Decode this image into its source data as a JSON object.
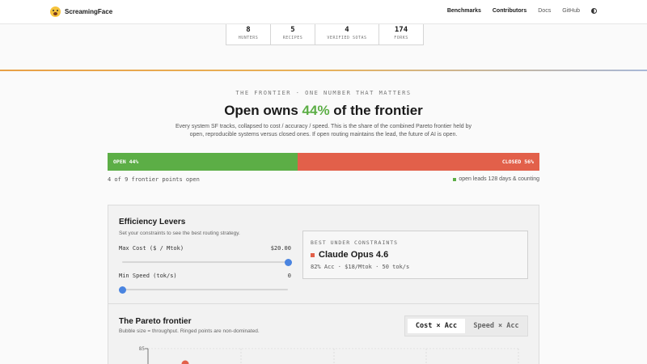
{
  "header": {
    "brand": "ScreamingFace",
    "logo_icon": "screaming-face-icon",
    "nav": [
      "Benchmarks",
      "Contributors",
      "Docs",
      "GitHub"
    ],
    "active_nav": [
      "Benchmarks",
      "Contributors"
    ],
    "theme_icon": "half-circle-icon"
  },
  "stats": [
    {
      "value": "8",
      "label": "HUNTERS"
    },
    {
      "value": "5",
      "label": "RECIPES"
    },
    {
      "value": "4",
      "label": "VERIFIED SOTAS"
    },
    {
      "value": "174",
      "label": "FORKS"
    }
  ],
  "frontier": {
    "eyebrow": "THE FRONTIER · ONE NUMBER THAT MATTERS",
    "headline_pre": "Open owns ",
    "headline_accent": "44%",
    "headline_post": " of the frontier",
    "description": "Every system SF tracks, collapsed to cost / accuracy / speed. This is the share of the combined Pareto frontier held by open, reproducible systems versus closed ones. If open routing maintains the lead, the future of AI is open.",
    "open_label": "OPEN 44%",
    "closed_label": "CLOSED 56%",
    "open_fraction": 0.44,
    "points_open": "4 of 9 frontier points open",
    "lead_text": "open leads 128 days & counting",
    "colors": {
      "open": "#5cae46",
      "closed": "#e2604a"
    }
  },
  "efficiency": {
    "title": "Efficiency Levers",
    "subtitle": "Set your constraints to see the best routing strategy.",
    "max_cost_label": "Max Cost ($ / Mtok)",
    "max_cost_value": "$20.00",
    "max_cost_fraction": 1.0,
    "min_speed_label": "Min Speed (tok/s)",
    "min_speed_value": "0",
    "min_speed_fraction": 0.0,
    "best": {
      "label": "BEST UNDER CONSTRAINTS",
      "name": "Claude Opus 4.6",
      "meta": "82% Acc · $18/Mtok · 50 tok/s",
      "color": "#e2604a"
    }
  },
  "pareto": {
    "title": "The Pareto frontier",
    "subtitle": "Bubble size = throughput. Ringed points are non-dominated.",
    "toggle": [
      "Cost × Acc",
      "Speed × Acc"
    ],
    "active_toggle": "Cost × Acc"
  },
  "chart_data": {
    "type": "scatter",
    "y_tick_labels": [
      "85"
    ],
    "points_visible": [
      {
        "series": "closed",
        "color": "#e2604a"
      }
    ]
  }
}
